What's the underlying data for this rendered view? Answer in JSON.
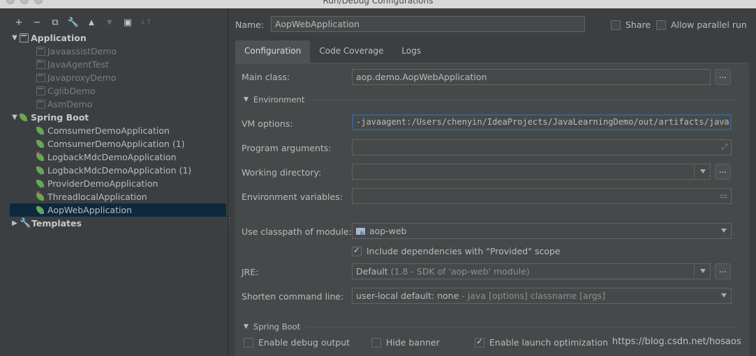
{
  "window": {
    "title": "Run/Debug Configurations"
  },
  "toolbar": {
    "add": "+",
    "remove": "−",
    "copy": "⧉",
    "edit": "🔧",
    "up": "▲",
    "down": "▼",
    "folder": "▣",
    "sort": "↓↑"
  },
  "tree": {
    "application_label": "Application",
    "application_items": [
      "JavaassistDemo",
      "JavaAgentTest",
      "JavaproxyDemo",
      "CglibDemo",
      "AsmDemo"
    ],
    "springboot_label": "Spring Boot",
    "springboot_items": [
      "ComsumerDemoApplication",
      "ComsumerDemoApplication (1)",
      "LogbackMdcDemoApplication",
      "LogbackMdcDemoApplication (1)",
      "ProviderDemoApplication",
      "ThreadlocalApplication",
      "AopWebApplication"
    ],
    "templates_label": "Templates"
  },
  "header": {
    "name_label": "Name:",
    "name_value": "AopWebApplication",
    "share_label": "Share",
    "parallel_label": "Allow parallel run"
  },
  "tabs": [
    "Configuration",
    "Code Coverage",
    "Logs"
  ],
  "config": {
    "main_class_label": "Main class:",
    "main_class_value": "aop.demo.AopWebApplication",
    "environment_section": "Environment",
    "vm_options_label": "VM options:",
    "vm_options_value": "-javaagent:/Users/chenyin/IdeaProjects/JavaLearningDemo/out/artifacts/java",
    "program_args_label": "Program arguments:",
    "working_dir_label": "Working directory:",
    "env_vars_label": "Environment variables:",
    "classpath_label": "Use classpath of module:",
    "classpath_value": "aop-web",
    "include_deps_label": "Include dependencies with \"Provided\" scope",
    "jre_label": "JRE:",
    "jre_value": "Default",
    "jre_detail": "(1.8 - SDK of 'aop-web' module)",
    "shorten_label": "Shorten command line:",
    "shorten_value": "user-local default: none",
    "shorten_detail": "- java [options] classname [args]",
    "springboot_section": "Spring Boot",
    "enable_debug_label": "Enable debug output",
    "hide_banner_label": "Hide banner",
    "launch_opt_label": "Enable launch optimization",
    "browse_label": "..."
  },
  "watermark": "https://blog.csdn.net/hosaos"
}
